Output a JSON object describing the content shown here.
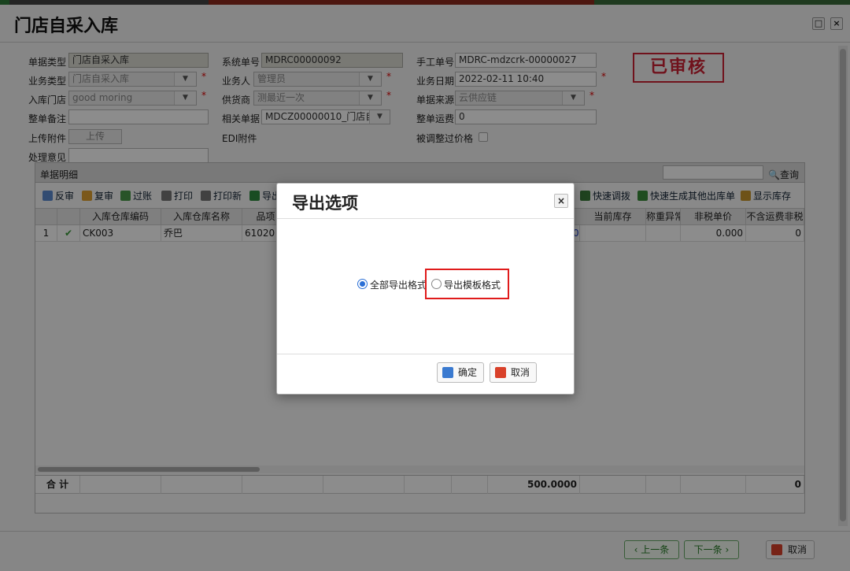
{
  "window": {
    "title": "门店自采入库",
    "restore_icon": "□",
    "close_icon": "×"
  },
  "form": {
    "doc_type_label": "单据类型",
    "doc_type_value": "门店自采入库",
    "sys_no_label": "系统单号",
    "sys_no_value": "MDRC00000092",
    "manual_no_label": "手工单号",
    "manual_no_value": "MDRC-mdzcrk-00000027",
    "biz_type_label": "业务类型",
    "biz_type_value": "门店自采入库",
    "salesman_label": "业务人",
    "salesman_value": "管理员",
    "biz_date_label": "业务日期",
    "biz_date_value": "2022-02-11 10:40",
    "store_label": "入库门店",
    "store_value": "good moring",
    "supplier_label": "供货商",
    "supplier_value": "测最近一次",
    "source_label": "单据来源",
    "source_value": "云供应链",
    "remark_label": "整单备注",
    "remark_value": "",
    "related_label": "相关单据",
    "related_value": "MDCZ00000010_门店自",
    "freight_label": "整单运费",
    "freight_value": "0",
    "attach_label": "上传附件",
    "upload_btn": "上传",
    "edi_label": "EDI附件",
    "price_adjusted_label": "被调整过价格",
    "opinion_label": "处理意见",
    "opinion_value": "",
    "stamp": "已审核",
    "required_mark": "*"
  },
  "details": {
    "title": "单据明细",
    "search_btn": "查询",
    "toolbar": [
      "反审",
      "复审",
      "过账",
      "打印",
      "打印新",
      "导出"
    ],
    "toolbar_right": [
      "快速调拨",
      "快速生成其他出库单",
      "显示库存"
    ],
    "columns": [
      "入库仓库编码",
      "入库仓库名称",
      "品项",
      "当前库存",
      "称重异常",
      "非税单价",
      "不含运费非税"
    ],
    "rows": [
      {
        "index": "1",
        "wh_code": "CK003",
        "wh_name": "乔巴",
        "item": "61020",
        "partial": "0",
        "price": "0.000",
        "tail": "0"
      }
    ],
    "footer": {
      "label": "合  计",
      "total": "500.0000",
      "tail": "0"
    }
  },
  "bottom": {
    "prev": "上一条",
    "next": "下一条",
    "cancel": "取消"
  },
  "dialog": {
    "title": "导出选项",
    "close": "×",
    "option_all": "全部导出格式",
    "option_template": "导出模板格式",
    "selected": "全部导出格式",
    "ok": "确定",
    "cancel": "取消"
  }
}
